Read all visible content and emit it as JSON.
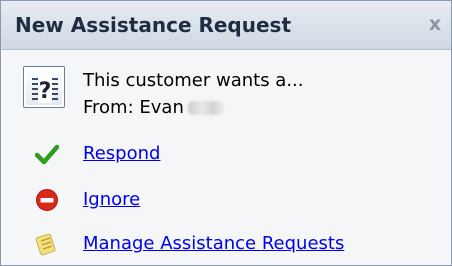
{
  "popup": {
    "title": "New Assistance Request",
    "close_glyph": "x"
  },
  "request": {
    "icon": "question-document-icon",
    "icon_glyph": "?",
    "message": "This customer wants a...",
    "from_label": "From: Evan"
  },
  "actions": [
    {
      "label": "Respond",
      "icon": "checkmark-icon",
      "color": "#2e9e1c"
    },
    {
      "label": "Ignore",
      "icon": "no-entry-icon",
      "color": "#d9291b"
    },
    {
      "label": "Manage Assistance Requests",
      "icon": "notepad-icon",
      "color": "#f3df7a"
    }
  ],
  "colors": {
    "link": "#0000ee",
    "title_text": "#1f2d42",
    "titlebar_bg": "#dce3ec"
  }
}
